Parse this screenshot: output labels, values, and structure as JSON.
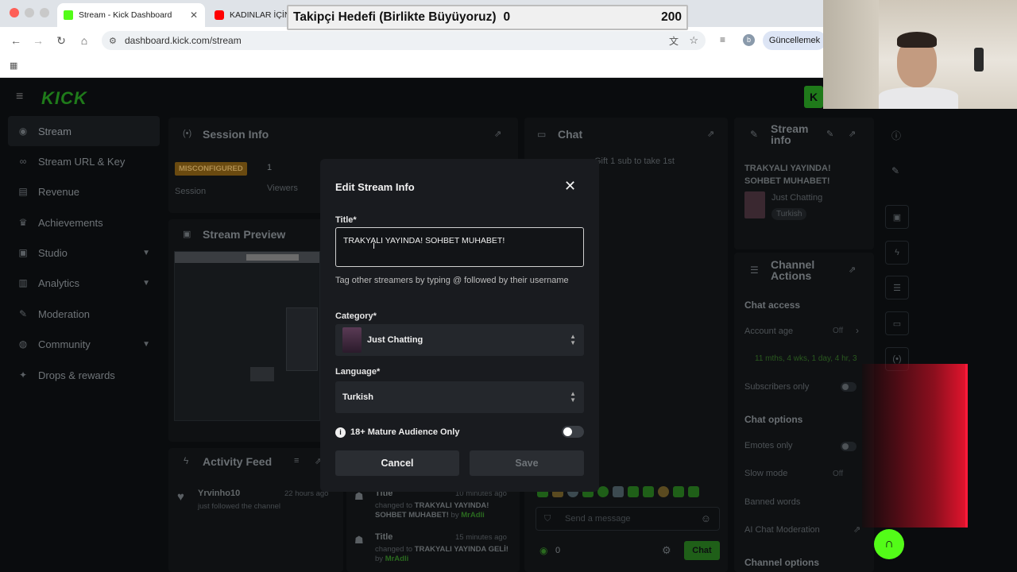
{
  "browser": {
    "tabs": [
      {
        "label": "Stream - Kick Dashboard",
        "active": true
      },
      {
        "label": "KADINLAR İÇİN",
        "active": false
      }
    ],
    "url": "dashboard.kick.com/stream",
    "update_label": "Güncellemek",
    "profile_initial": "b"
  },
  "goal_overlay": {
    "label": "Takipçi Hedefi (Birlikte Büyüyoruz)",
    "current": "0",
    "target": "200"
  },
  "brand": {
    "logo": "KICK",
    "accent": "#53fc18"
  },
  "sidebar": {
    "items": [
      {
        "label": "Stream",
        "icon": "broadcast-icon"
      },
      {
        "label": "Stream URL & Key",
        "icon": "link-icon"
      },
      {
        "label": "Revenue",
        "icon": "money-icon"
      },
      {
        "label": "Achievements",
        "icon": "trophy-icon"
      },
      {
        "label": "Studio",
        "icon": "studio-icon"
      },
      {
        "label": "Analytics",
        "icon": "chart-icon"
      },
      {
        "label": "Moderation",
        "icon": "wrench-icon"
      },
      {
        "label": "Community",
        "icon": "globe-icon"
      },
      {
        "label": "Drops & rewards",
        "icon": "gift-icon"
      }
    ]
  },
  "session": {
    "title": "Session Info",
    "status": "MISCONFIGURED",
    "status_label": "Session",
    "viewers_value": "1",
    "viewers_label": "Viewers"
  },
  "preview": {
    "title": "Stream Preview"
  },
  "activity": {
    "title": "Activity Feed",
    "items": [
      {
        "user": "Yrvinho10",
        "time": "22 hours ago",
        "text": "just followed the channel"
      }
    ]
  },
  "title_changes": [
    {
      "label": "Title",
      "time": "10 minutes ago",
      "prefix": "changed to",
      "value": "TRAKYALI YAYINDA! SOHBET MUHABET!",
      "by": "by",
      "user": "MrAdli"
    },
    {
      "label": "Title",
      "time": "15 minutes ago",
      "prefix": "changed to",
      "value": "TRAKYALI YAYINDA GELİ!",
      "by": "by",
      "user": "MrAdli"
    }
  ],
  "chat": {
    "title": "Chat",
    "gift_banner": "Gift 1 sub to take 1st",
    "placeholder": "Send a message",
    "count": "0",
    "send_label": "Chat"
  },
  "stream_info": {
    "title": "Stream info",
    "stream_title": "TRAKYALI YAYINDA! SOHBET MUHABET!",
    "category": "Just Chatting",
    "language": "Turkish"
  },
  "channel_actions": {
    "title": "Channel Actions",
    "chat_access": "Chat access",
    "account_age": "Account age",
    "account_age_state": "Off",
    "account_age_detail": "11 mths, 4 wks, 1 day, 4 hr, 3",
    "subscribers_only": "Subscribers only",
    "chat_options": "Chat options",
    "emotes_only": "Emotes only",
    "slow_mode": "Slow mode",
    "slow_mode_state": "Off",
    "banned_words": "Banned words",
    "ai_moderation": "AI Chat Moderation",
    "channel_options": "Channel options"
  },
  "modal": {
    "title": "Edit Stream Info",
    "title_label": "Title*",
    "title_value": "TRAKYALI YAYINDA! SOHBET MUHABET!",
    "helper": "Tag other streamers by typing @ followed by their username",
    "category_label": "Category*",
    "category_value": "Just Chatting",
    "language_label": "Language*",
    "language_value": "Turkish",
    "mature_label": "18+ Mature Audience Only",
    "mature_on": false,
    "cancel_label": "Cancel",
    "save_label": "Save"
  }
}
